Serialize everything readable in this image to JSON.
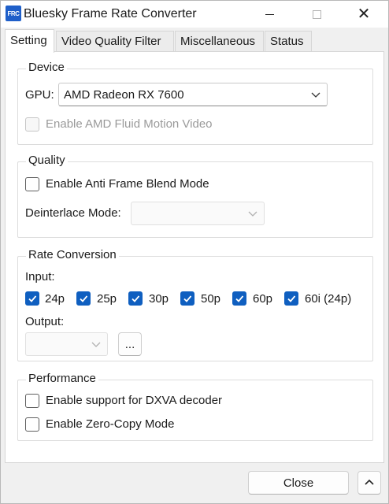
{
  "window": {
    "icon_text": "FRC",
    "title": "Bluesky Frame Rate Converter",
    "close_glyph": "✕"
  },
  "tabs": [
    {
      "label": "Setting",
      "active": true
    },
    {
      "label": "Video Quality Filter",
      "active": false
    },
    {
      "label": "Miscellaneous",
      "active": false
    },
    {
      "label": "Status",
      "active": false
    }
  ],
  "device": {
    "title": "Device",
    "gpu_label": "GPU:",
    "gpu_value": "AMD Radeon RX 7600",
    "fluid_motion_label": "Enable AMD Fluid Motion Video",
    "fluid_motion_checked": false
  },
  "quality": {
    "title": "Quality",
    "anti_blend_label": "Enable Anti Frame Blend Mode",
    "anti_blend_checked": false,
    "deinterlace_label": "Deinterlace Mode:",
    "deinterlace_value": ""
  },
  "rate": {
    "title": "Rate Conversion",
    "input_label": "Input:",
    "inputs": [
      {
        "label": "24p",
        "checked": true
      },
      {
        "label": "25p",
        "checked": true
      },
      {
        "label": "30p",
        "checked": true
      },
      {
        "label": "50p",
        "checked": true
      },
      {
        "label": "60p",
        "checked": true
      },
      {
        "label": "60i (24p)",
        "checked": true
      }
    ],
    "output_label": "Output:",
    "output_value": "",
    "more_button": "..."
  },
  "performance": {
    "title": "Performance",
    "dxva_label": "Enable support for DXVA decoder",
    "dxva_checked": false,
    "zero_copy_label": "Enable Zero-Copy Mode",
    "zero_copy_checked": false
  },
  "footer": {
    "close_button": "Close",
    "expand_glyph": "^"
  },
  "colors": {
    "accent": "#0f5fc0",
    "app_icon": "#1f5fc9"
  }
}
